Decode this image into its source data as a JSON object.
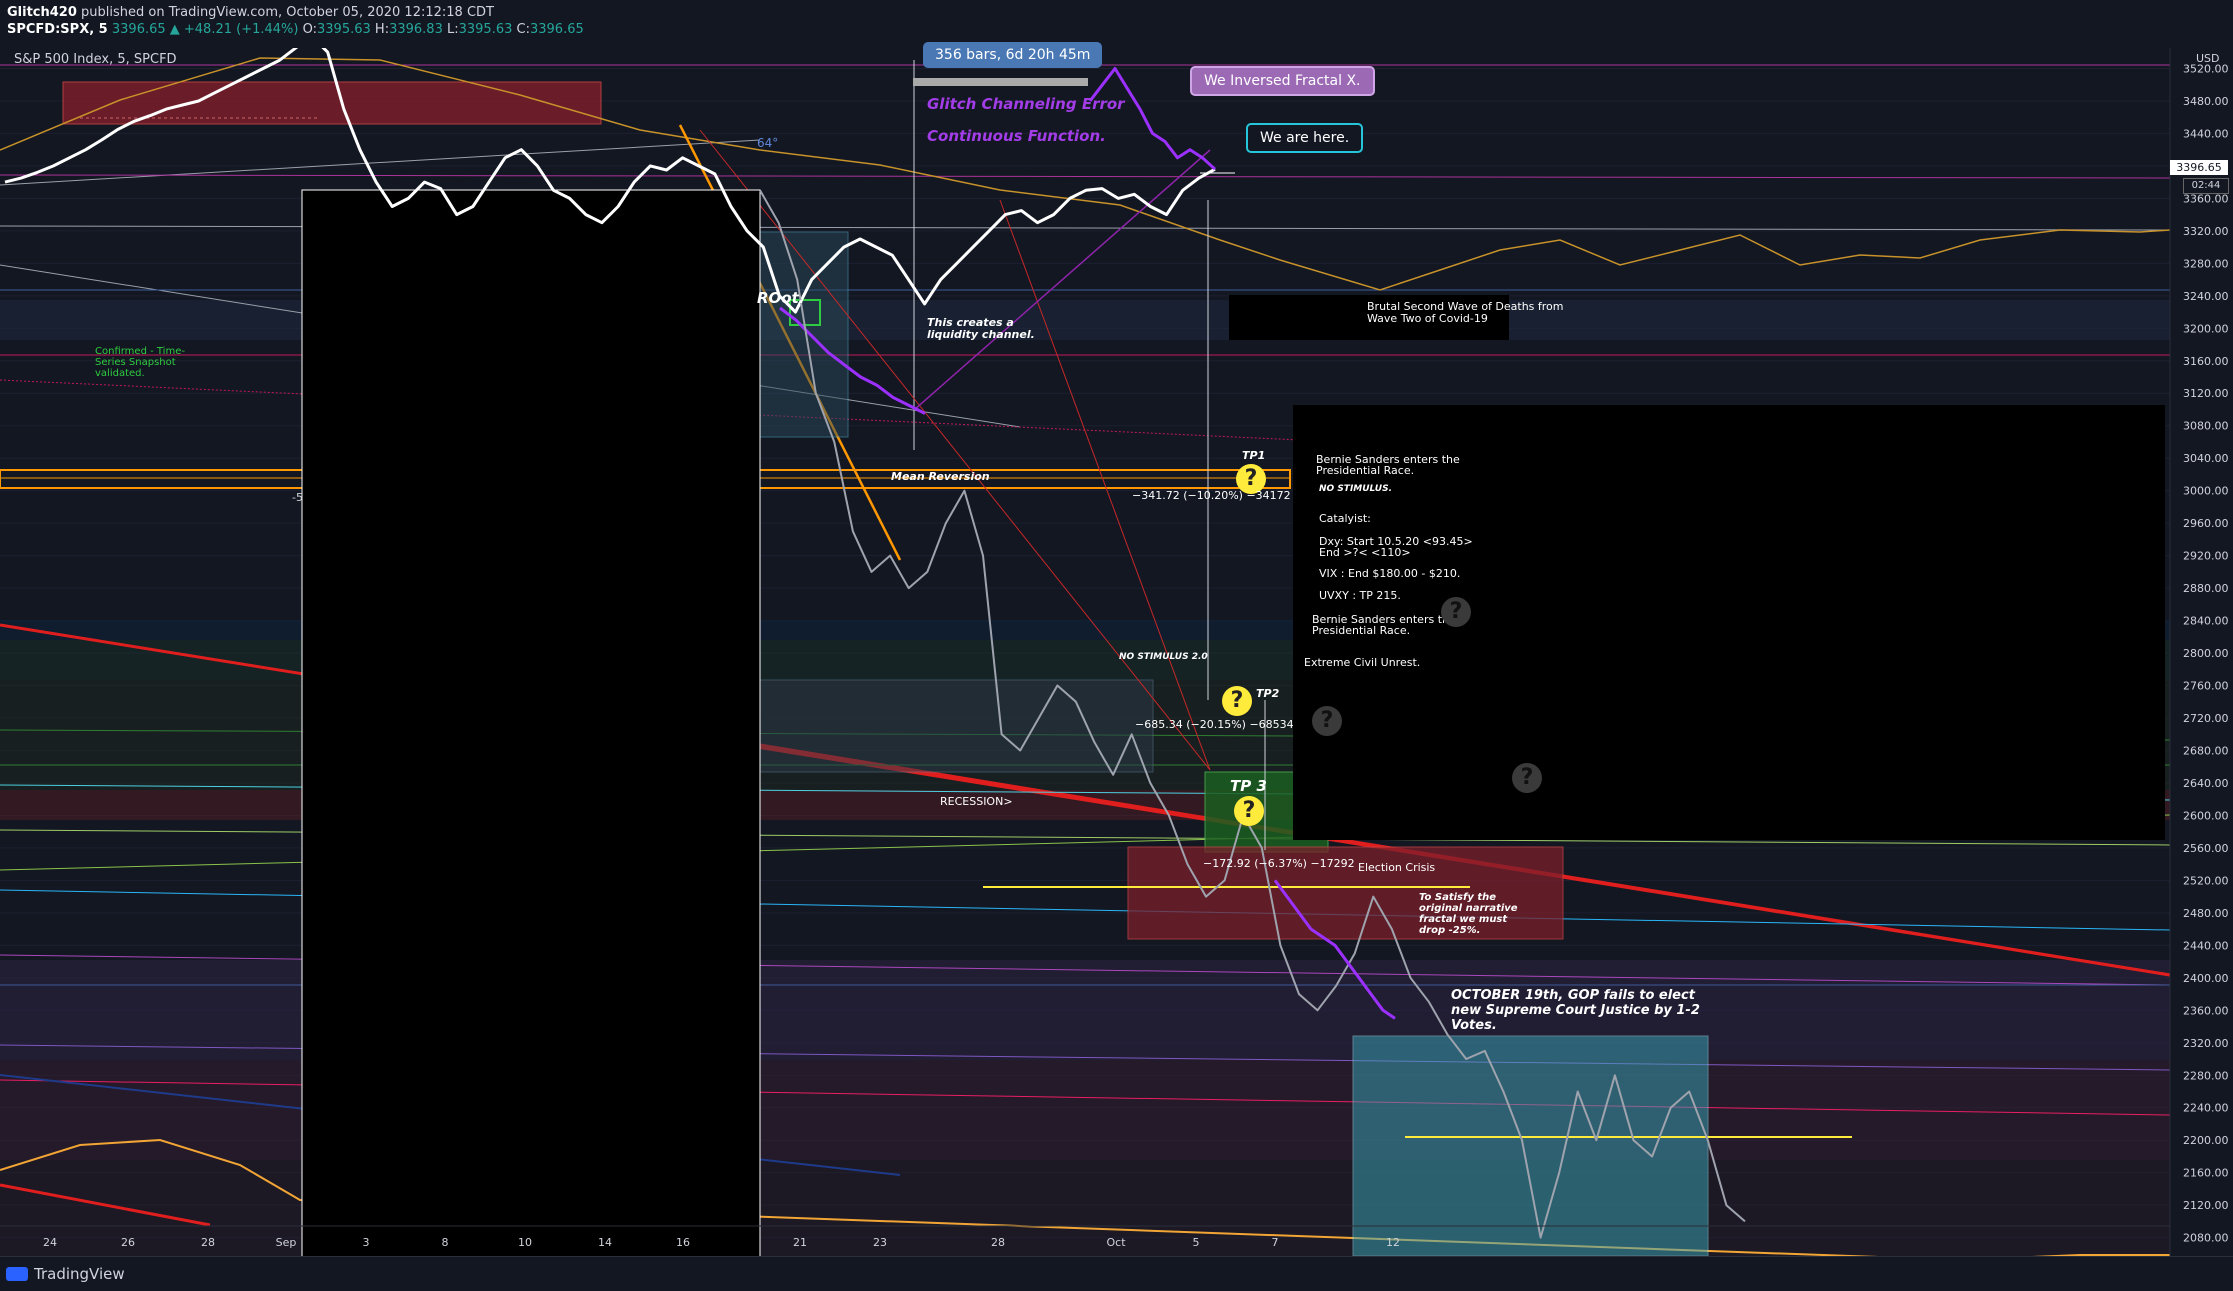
{
  "header": {
    "author": "Glitch420",
    "published_text": "published on TradingView.com, October 05, 2020 12:12:18 CDT",
    "ticker": "SPCFD:SPX, 5",
    "change": "3396.65 ▲ +48.21 (+1.44%)",
    "o_label": "O:",
    "o_val": "3395.63",
    "h_label": "H:",
    "h_val": "3396.83",
    "l_label": "L:",
    "l_val": "3395.63",
    "c_label": "C:",
    "c_val": "3396.65"
  },
  "symbol_title": "S&P 500 Index, 5, SPCFD",
  "currency": "USD",
  "price_tag": "3396.65",
  "time_tag": "02:44",
  "footer": {
    "brand": "TradingView"
  },
  "annotations": {
    "bars_box": "356 bars, 6d 20h 45m",
    "glitch1": "Glitch Channeling Error",
    "glitch2": "Continuous Function.",
    "inversed": "We Inversed Fractal X.",
    "here": "We are here.",
    "angle": "64°",
    "root": "ROot.",
    "liquidity1": "This creates a",
    "liquidity2": "liquidity channel.",
    "confirmed1": "Confirmed - Time-",
    "confirmed2": "Series Snapshot",
    "confirmed3": "validated.",
    "brutal1": "Brutal Second Wave of Deaths from",
    "brutal2": "Wave Two of Covid-19",
    "mean_rev": "Mean Reversion",
    "tp1": "TP1",
    "tp1_measure": "−341.72 (−10.20%) −34172",
    "bernie1": "Bernie Sanders enters the",
    "bernie2": "Presidential Race.",
    "no_stim": "NO STIMULUS.",
    "catalyst": "Catalyist:",
    "dxy1": "Dxy: Start 10.5.20 <93.45>",
    "dxy2": "End >?< <110>",
    "vix": "VIX : End $180.00 - $210.",
    "uvxy": "UVXY : TP 215.",
    "bernie3": "Bernie Sanders enters the",
    "bernie4": "Presidential Race.",
    "unrest": "Extreme Civil Unrest.",
    "no_stim2": "NO STIMULUS 2.0",
    "tp2": "TP2",
    "tp2_measure": "−685.34 (−20.15%) −68534",
    "tp3": "TP 3",
    "recession": "RECESSION>",
    "tp3_measure": "−172.92 (−6.37%) −17292",
    "election": "Election Crisis",
    "satisfy1": "To Satisfy the",
    "satisfy2": "original narrative",
    "satisfy3": "fractal we must",
    "satisfy4": "drop -25%.",
    "oct19_1": "OCTOBER 19th, GOP fails to elect",
    "oct19_2": "new Supreme Court Justice by 1-2",
    "oct19_3": "Votes.",
    "q": "?",
    "minus5": "-5"
  },
  "colors": {
    "background": "#131722",
    "price": "#ffffff",
    "projection": "#9b30ff",
    "ghost": "#9ea3ad",
    "orange": "#ff9800",
    "red": "#f23645",
    "teal_box": "#4fb3c9",
    "green_box": "#1b5e20",
    "maroon_box": "#7a1f2b",
    "yellow": "#ffeb3b",
    "callout_purple": "#a17fb8",
    "callout_teal": "#26c6da"
  },
  "chart_data": {
    "type": "line",
    "title": "S&P 500 Index, 5, SPCFD",
    "ylim": [
      2050,
      3560
    ],
    "y_ticks": [
      2080,
      2120,
      2160,
      2200,
      2240,
      2280,
      2320,
      2360,
      2400,
      2440,
      2480,
      2520,
      2560,
      2600,
      2640,
      2680,
      2720,
      2760,
      2800,
      2840,
      2880,
      2920,
      2960,
      3000,
      3040,
      3080,
      3120,
      3160,
      3200,
      3240,
      3280,
      3320,
      3360,
      3400,
      3440,
      3480,
      3520
    ],
    "x_ticks": [
      "24",
      "26",
      "28",
      "Sep",
      "3",
      "8",
      "10",
      "14",
      "16",
      "21",
      "23",
      "28",
      "Oct",
      "5",
      "7",
      "12"
    ],
    "series": [
      {
        "values": [
          3380,
          3385,
          3392,
          3400,
          3410,
          3420,
          3432,
          3445,
          3455,
          3462,
          3470,
          3475,
          3480,
          3490,
          3500,
          3510,
          3520,
          3530,
          3545,
          3560,
          3540,
          3470,
          3420,
          3380,
          3350,
          3360,
          3380,
          3372,
          3340,
          3350,
          3380,
          3410,
          3420,
          3400,
          3370,
          3360,
          3340,
          3330,
          3350,
          3380,
          3400,
          3395,
          3410,
          3400,
          3390,
          3350,
          3320,
          3300,
          3240,
          3220,
          3260,
          3280,
          3300,
          3310,
          3300,
          3290,
          3260,
          3230,
          3260,
          3280,
          3300,
          3320,
          3340,
          3345,
          3330,
          3340,
          3360,
          3370,
          3372,
          3360,
          3365,
          3350,
          3340,
          3370,
          3385,
          3396
        ]
      },
      {
        "values": [
          3225,
          3210,
          3190,
          3170,
          3155,
          3140,
          3130,
          3115,
          3105,
          3095
        ]
      },
      {
        "values": [
          3480,
          3500,
          3520,
          3495,
          3470,
          3440,
          3430,
          3410,
          3420,
          3410,
          3396
        ]
      },
      {
        "values": [
          3370,
          3330,
          3260,
          3120,
          3060,
          2950,
          2900,
          2920,
          2880,
          2900,
          2960,
          3000,
          2920,
          2700,
          2680,
          2720,
          2760,
          2740,
          2690,
          2650,
          2700,
          2640,
          2600,
          2540,
          2500,
          2520,
          2600,
          2560,
          2440,
          2380,
          2360,
          2390,
          2430,
          2500,
          2460,
          2400,
          2370,
          2330,
          2300,
          2310,
          2260,
          2200,
          2080,
          2160,
          2260,
          2200,
          2280,
          2200,
          2180,
          2240,
          2260,
          2200,
          2120,
          2100
        ]
      },
      {
        "values": [
          2520,
          2500,
          2480,
          2460,
          2450,
          2440,
          2420,
          2400,
          2380,
          2360,
          2350
        ]
      }
    ]
  }
}
